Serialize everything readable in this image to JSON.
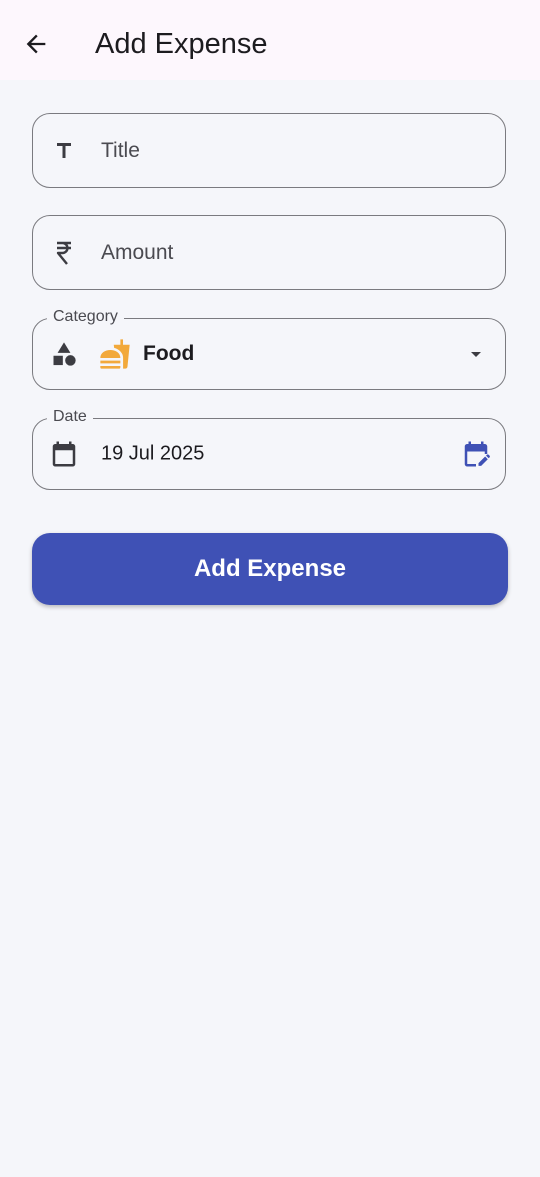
{
  "app_bar": {
    "title": "Add Expense",
    "back_icon": "arrow-back-icon"
  },
  "form": {
    "title_field": {
      "placeholder": "Title",
      "icon": "title-icon"
    },
    "amount_field": {
      "placeholder": "Amount",
      "icon": "rupee-icon"
    },
    "category_field": {
      "label": "Category",
      "value": "Food",
      "icon": "category-icon",
      "value_icon": "fastfood-icon",
      "dropdown_icon": "dropdown-arrow-icon"
    },
    "date_field": {
      "label": "Date",
      "value": "19 Jul 2025",
      "icon": "calendar-icon",
      "edit_icon": "edit-calendar-icon"
    },
    "submit_label": "Add Expense"
  },
  "colors": {
    "primary": "#3f51b5",
    "food_icon": "#f2a93b",
    "outline": "#7a7a7f",
    "background": "#f5f6fa",
    "app_bar": "#fdf7fd"
  }
}
